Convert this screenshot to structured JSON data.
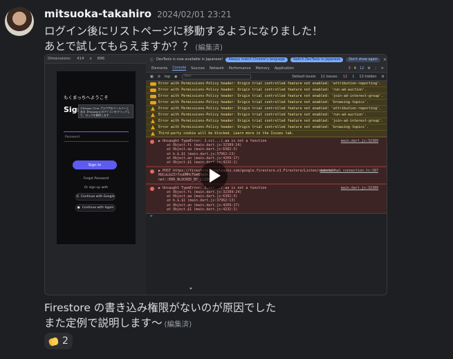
{
  "message": {
    "username": "mitsuoka-takahiro",
    "timestamp": "2024/02/01 23:21",
    "line1": "ログイン後にリストページに移動するようになりました！",
    "line2": "あとで試してもらえますか？？",
    "edited_label": "(編集済)",
    "line3": "Firestore の書き込み権限がないのが原因でした",
    "line4": "また定例で説明します〜",
    "edited_label_2": "(編集済)"
  },
  "reaction": {
    "emoji": "clap-icon",
    "count": "2"
  },
  "attachment": {
    "device_toolbar": {
      "device": "Dimensions:",
      "width": "414",
      "sep": "x",
      "height": "896"
    },
    "phone": {
      "welcome": "もくまっちへようこそ",
      "title": "Sign In",
      "tooltip": "©Elanas 7/1m ブラウザのツールバーにある【Password のアイコンをクリックして、ロックを解除します",
      "password_label": "Password",
      "signin_button": "Sign In",
      "forgot": "Forgot Password",
      "or": "Or sign up with",
      "google": "Continue with Google",
      "apple": "Continue with Apple"
    },
    "devtools": {
      "infobar_text": "DevTools is now available in Japanese!",
      "infobar_btn1": "Always match Chrome's language",
      "infobar_btn2": "Switch DevTools to Japanese",
      "infobar_btn3": "Don't show again",
      "tabs": [
        "Elements",
        "Console",
        "Sources",
        "Network",
        "Performance",
        "Memory",
        "Application"
      ],
      "tab_active_index": 1,
      "counts": {
        "errors": "3",
        "warnings": "4",
        "messages": "12"
      },
      "toolbar": {
        "context": "top",
        "filter_placeholder": "Filter",
        "levels": "Default levels",
        "issues": "11 Issues:",
        "issues_err": "12",
        "issues_info": "1",
        "hidden": "13 hidden"
      },
      "warnings": [
        "Error with Permissions-Policy header: Origin trial controlled feature not enabled: 'attribution-reporting'.",
        "Error with Permissions-Policy header: Origin trial controlled feature not enabled: 'run-ad-auction'.",
        "Error with Permissions-Policy header: Origin trial controlled feature not enabled: 'join-ad-interest-group'.",
        "Error with Permissions-Policy header: Origin trial controlled feature not enabled: 'browsing-topics'.",
        "Error with Permissions-Policy header: Origin trial controlled feature not enabled: 'attribution-reporting'.",
        "Error with Permissions-Policy header: Origin trial controlled feature not enabled: 'run-ad-auction'.",
        "Error with Permissions-Policy header: Origin trial controlled feature not enabled: 'join-ad-interest-group'.",
        "Error with Permissions-Policy header: Origin trial controlled feature not enabled: 'browsing-topics'.",
        "Third-party cookie will be blocked. Learn more in the Issues tab."
      ],
      "warn_badges": [
        "2",
        "2",
        "2",
        "2"
      ],
      "error1": {
        "head": "▶ Uncaught TypeError: J.cc(...).aa is not a function",
        "src": "main.dart.js:32389",
        "frames": [
          "at Object.fi (main.dart.js:32389:24)",
          "at Object.aa (main.dart.js:6382:3)",
          "at b.$.$1 (main.dart.js:37962:13)",
          "at Object.an (main.dart.js:4209:17)",
          "at Object.$1 (main.dart.js:4232:1)"
        ]
      },
      "error2": {
        "head": "▶ POST https://firestore.googleapis.com/google.firestore.v1.Firestore/Listen/channel?...",
        "src": "webchannel_connection.ts:287",
        "line2": "RGCuLb2Zr7xoDMHcTbmKBpbh...",
        "line3": "net::ERR_BLOCKED_BY_CLIENT"
      },
      "error3": {
        "head": "▶ Uncaught TypeError: J.cc(...).aa is not a function",
        "src": "main.dart.js:32389",
        "frames": [
          "at Object.fi (main.dart.js:32389:24)",
          "at Object.aa (main.dart.js:6382:3)",
          "at b.$.$1 (main.dart.js:37962:13)",
          "at Object.an (main.dart.js:4209:17)",
          "at Object.$1 (main.dart.js:4232:1)"
        ]
      },
      "prompt": ">"
    }
  }
}
